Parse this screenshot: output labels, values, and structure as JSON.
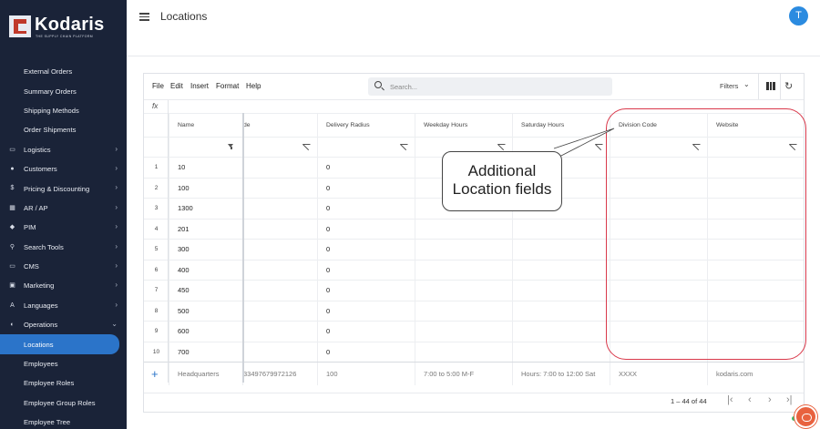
{
  "app": {
    "logo_text": "Kodaris",
    "logo_tagline": "THE SUPPLY CHAIN PLATFORM"
  },
  "sidebar": {
    "items": [
      {
        "label": "External Orders",
        "icon": "",
        "expandable": false,
        "active": false,
        "sub": true
      },
      {
        "label": "Summary Orders",
        "icon": "",
        "expandable": false,
        "active": false,
        "sub": true
      },
      {
        "label": "Shipping Methods",
        "icon": "",
        "expandable": false,
        "active": false,
        "sub": true
      },
      {
        "label": "Order Shipments",
        "icon": "",
        "expandable": false,
        "active": false,
        "sub": true
      },
      {
        "label": "Logistics",
        "icon": "truck-icon",
        "expandable": true,
        "active": false,
        "sub": false
      },
      {
        "label": "Customers",
        "icon": "users-icon",
        "expandable": true,
        "active": false,
        "sub": false
      },
      {
        "label": "Pricing & Discounting",
        "icon": "dollar-icon",
        "expandable": true,
        "active": false,
        "sub": false
      },
      {
        "label": "AR / AP",
        "icon": "building-icon",
        "expandable": true,
        "active": false,
        "sub": false
      },
      {
        "label": "PIM",
        "icon": "tag-icon",
        "expandable": true,
        "active": false,
        "sub": false
      },
      {
        "label": "Search Tools",
        "icon": "search-icon",
        "expandable": true,
        "active": false,
        "sub": false
      },
      {
        "label": "CMS",
        "icon": "window-icon",
        "expandable": true,
        "active": false,
        "sub": false
      },
      {
        "label": "Marketing",
        "icon": "image-icon",
        "expandable": true,
        "active": false,
        "sub": false
      },
      {
        "label": "Languages",
        "icon": "translate-icon",
        "expandable": true,
        "active": false,
        "sub": false
      },
      {
        "label": "Operations",
        "icon": "palette-icon",
        "expandable": true,
        "expanded": true,
        "active": false,
        "sub": false
      },
      {
        "label": "Locations",
        "icon": "",
        "expandable": false,
        "active": true,
        "sub": true
      },
      {
        "label": "Employees",
        "icon": "",
        "expandable": false,
        "active": false,
        "sub": true
      },
      {
        "label": "Employee Roles",
        "icon": "",
        "expandable": false,
        "active": false,
        "sub": true
      },
      {
        "label": "Employee Group Roles",
        "icon": "",
        "expandable": false,
        "active": false,
        "sub": true
      },
      {
        "label": "Employee Tree",
        "icon": "",
        "expandable": false,
        "active": false,
        "sub": true
      }
    ]
  },
  "header": {
    "title": "Locations",
    "avatar_initial": "T"
  },
  "toolbar": {
    "menus": [
      "File",
      "Edit",
      "Insert",
      "Format",
      "Help"
    ],
    "search_placeholder": "Search...",
    "filters_label": "Filters"
  },
  "formula_bar": {
    "label": "fx"
  },
  "grid": {
    "columns": [
      {
        "label": "Name",
        "filter": "on"
      },
      {
        "label": "de",
        "filter": "off"
      },
      {
        "label": "Delivery Radius",
        "filter": "off"
      },
      {
        "label": "Weekday Hours",
        "filter": "off"
      },
      {
        "label": "Saturday Hours",
        "filter": "off"
      },
      {
        "label": "Division Code",
        "filter": "off"
      },
      {
        "label": "Website",
        "filter": "off"
      }
    ],
    "rows": [
      {
        "num": "1",
        "cells": [
          "10",
          "",
          "0",
          "",
          "",
          "",
          ""
        ]
      },
      {
        "num": "2",
        "cells": [
          "100",
          "",
          "0",
          "",
          "",
          "",
          ""
        ]
      },
      {
        "num": "3",
        "cells": [
          "1300",
          "",
          "0",
          "",
          "",
          "",
          ""
        ]
      },
      {
        "num": "4",
        "cells": [
          "201",
          "",
          "0",
          "",
          "",
          "",
          ""
        ]
      },
      {
        "num": "5",
        "cells": [
          "300",
          "",
          "0",
          "",
          "",
          "",
          ""
        ]
      },
      {
        "num": "6",
        "cells": [
          "400",
          "",
          "0",
          "",
          "",
          "",
          ""
        ]
      },
      {
        "num": "7",
        "cells": [
          "450",
          "",
          "0",
          "",
          "",
          "",
          ""
        ]
      },
      {
        "num": "8",
        "cells": [
          "500",
          "",
          "0",
          "",
          "",
          "",
          ""
        ]
      },
      {
        "num": "9",
        "cells": [
          "600",
          "",
          "0",
          "",
          "",
          "",
          ""
        ]
      },
      {
        "num": "10",
        "cells": [
          "700",
          "",
          "0",
          "",
          "",
          "",
          ""
        ]
      }
    ],
    "new_row": [
      "Headquarters",
      "33497679972126",
      "100",
      "7:00 to 5:00 M-F",
      "Hours: 7:00 to 12:00 Sat",
      "XXXX",
      "kodaris.com"
    ]
  },
  "pagination": {
    "range_text": "1 – 44 of 44"
  },
  "callout": {
    "line1": "Additional",
    "line2": "Location fields"
  },
  "colors": {
    "sidebar_bg": "#1a2338",
    "accent": "#2b74c9",
    "highlight": "#d9394b",
    "chat": "#e8623f"
  }
}
